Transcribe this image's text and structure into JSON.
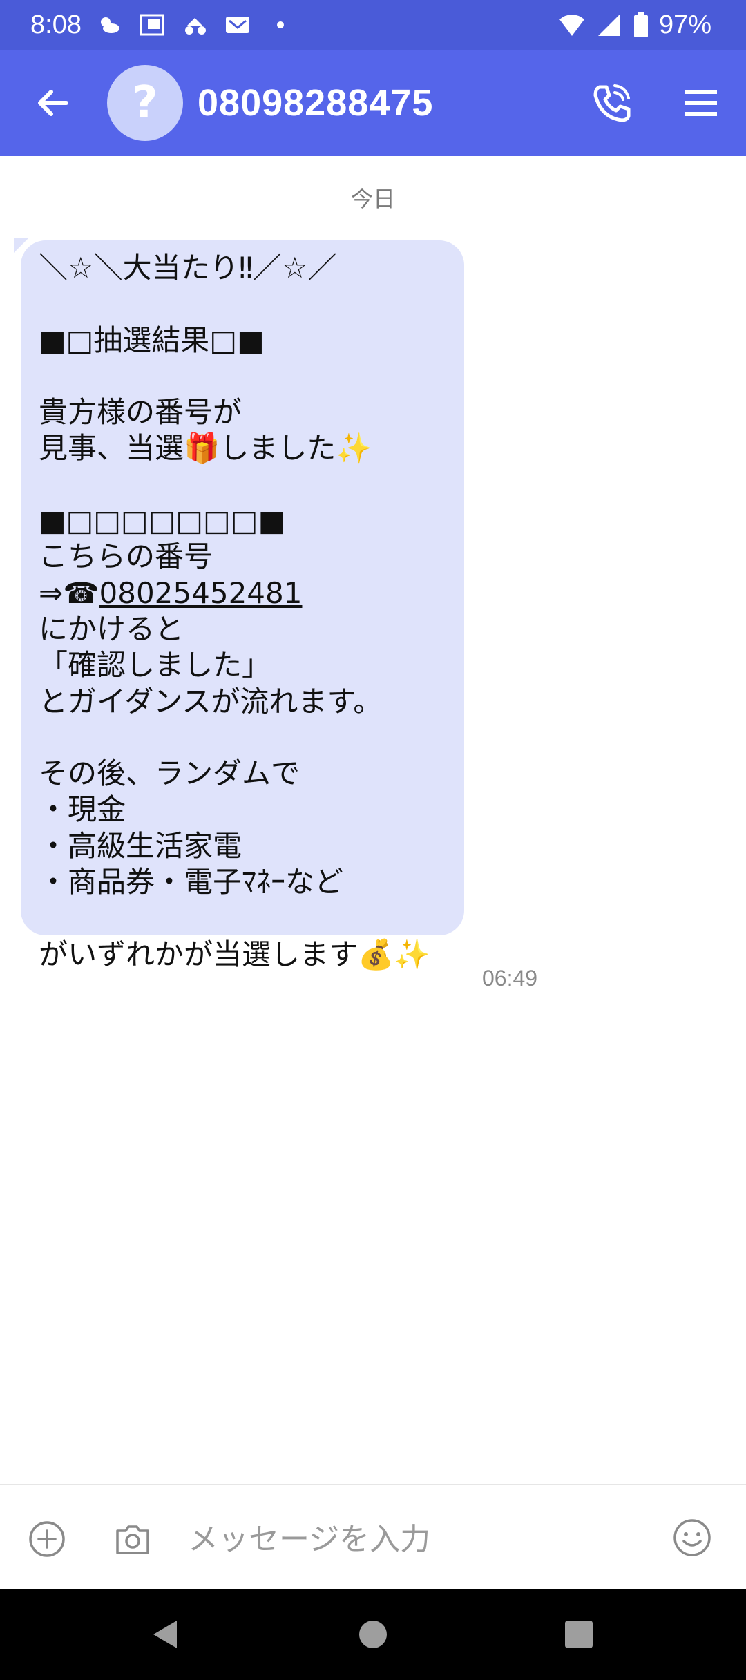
{
  "status_bar": {
    "time": "8:08",
    "battery": "97%",
    "icons": [
      "weather-icon",
      "carrier-au-icon",
      "app-notification-icon",
      "gmail-icon",
      "dot-icon",
      "wifi-icon",
      "signal-icon",
      "battery-icon"
    ]
  },
  "header": {
    "avatar_glyph": "?",
    "title": "08098288475",
    "accent_color": "#5565ea"
  },
  "conversation": {
    "date_label": "今日",
    "message": {
      "lines": [
        "＼☆＼大当たり‼／☆／",
        "",
        "■□抽選結果□■",
        "",
        "貴方様の番号が",
        "見事、当選🎁しました✨",
        "",
        "■□□□□□□□■",
        "こちらの番号",
        "⇒☎",
        "にかけると",
        "「確認しました」",
        "とガイダンスが流れます。",
        "",
        "その後、ランダムで",
        "・現金",
        "・高級生活家電",
        "・商品券・電子ﾏﾈｰなど",
        "",
        "がいずれかが当選します💰✨"
      ],
      "phone_link": "08025452481",
      "time": "06:49",
      "bubble_color": "#dfe3fb"
    }
  },
  "input_bar": {
    "placeholder": "メッセージを入力"
  }
}
